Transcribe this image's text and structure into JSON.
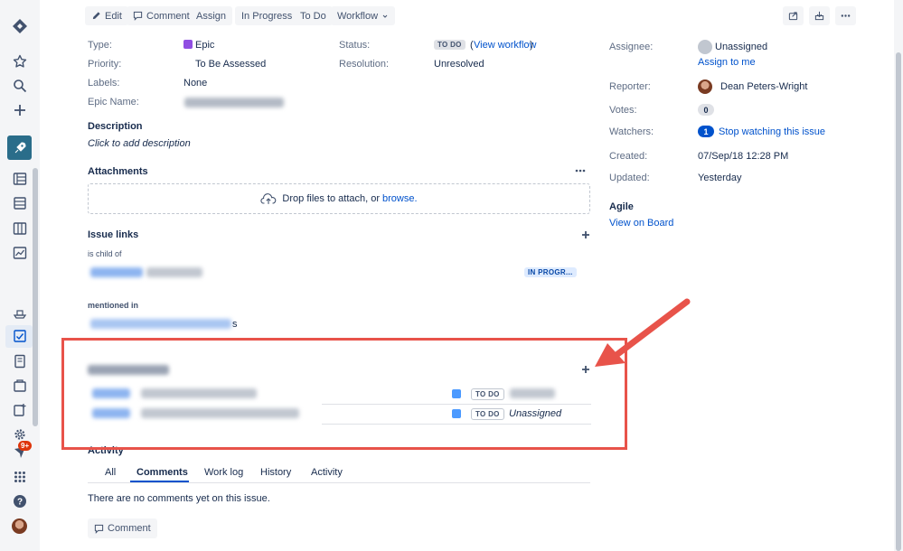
{
  "toolbar": {
    "edit": "Edit",
    "comment": "Comment",
    "assign": "Assign",
    "in_progress": "In Progress",
    "to_do": "To Do",
    "workflow": "Workflow"
  },
  "details": {
    "type_label": "Type:",
    "type_value": "Epic",
    "priority_label": "Priority:",
    "priority_value": "To Be Assessed",
    "labels_label": "Labels:",
    "labels_value": "None",
    "epic_name_label": "Epic Name:",
    "status_label": "Status:",
    "status_value": "TO DO",
    "view_workflow_open": "(",
    "view_workflow": "View workflow",
    "view_workflow_close": ")",
    "resolution_label": "Resolution:",
    "resolution_value": "Unresolved"
  },
  "description": {
    "title": "Description",
    "placeholder": "Click to add description"
  },
  "attachments": {
    "title": "Attachments",
    "drop_text": "Drop files to attach, or",
    "browse": "browse."
  },
  "issue_links": {
    "title": "Issue links",
    "is_child_of": "is child of",
    "child_status": "IN PROGR...",
    "mentioned_in": "mentioned in",
    "mentioned_suffix": "s"
  },
  "epic_issues": {
    "rows": [
      {
        "status": "TO DO",
        "assignee": ""
      },
      {
        "status": "TO DO",
        "assignee": "Unassigned"
      }
    ]
  },
  "activity": {
    "title": "Activity",
    "tabs": [
      "All",
      "Comments",
      "Work log",
      "History",
      "Activity"
    ],
    "active_tab": "Comments",
    "empty_text": "There are no comments yet on this issue.",
    "comment_button": "Comment"
  },
  "people": {
    "assignee_label": "Assignee:",
    "assignee_value": "Unassigned",
    "assign_to_me": "Assign to me",
    "reporter_label": "Reporter:",
    "reporter_value": "Dean Peters-Wright",
    "votes_label": "Votes:",
    "votes_count": "0",
    "watchers_label": "Watchers:",
    "watchers_count": "1",
    "stop_watching": "Stop watching this issue"
  },
  "dates": {
    "created_label": "Created:",
    "created_value": "07/Sep/18 12:28 PM",
    "updated_label": "Updated:",
    "updated_value": "Yesterday"
  },
  "agile": {
    "title": "Agile",
    "view_on_board": "View on Board"
  },
  "sidebar": {
    "notification_badge": "9+"
  },
  "colors": {
    "accent": "#0052cc",
    "annotation_red": "#e8534a",
    "project_icon": "#2a6d8a",
    "epic_purple": "#904ee2"
  }
}
